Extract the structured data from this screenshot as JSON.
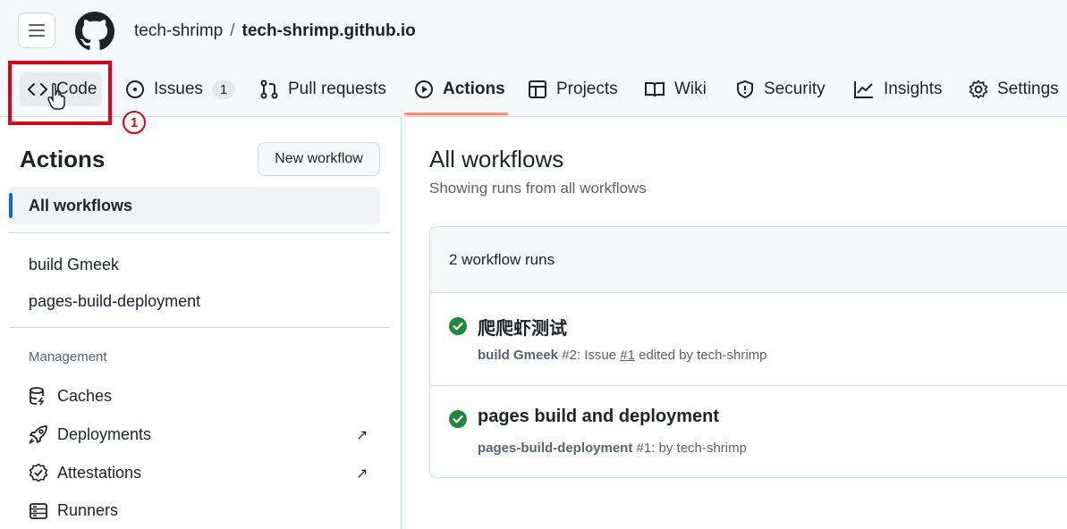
{
  "header": {
    "owner": "tech-shrimp",
    "separator": "/",
    "repo": "tech-shrimp.github.io"
  },
  "tabs": [
    {
      "label": "Code",
      "icon": "code-icon"
    },
    {
      "label": "Issues",
      "icon": "issue-opened-icon",
      "count": "1"
    },
    {
      "label": "Pull requests",
      "icon": "git-pull-request-icon"
    },
    {
      "label": "Actions",
      "icon": "play-icon",
      "active": true
    },
    {
      "label": "Projects",
      "icon": "table-icon"
    },
    {
      "label": "Wiki",
      "icon": "book-icon"
    },
    {
      "label": "Security",
      "icon": "shield-icon"
    },
    {
      "label": "Insights",
      "icon": "graph-icon"
    },
    {
      "label": "Settings",
      "icon": "gear-icon"
    }
  ],
  "annotation": {
    "step": "1",
    "color": "#e0001b"
  },
  "sidebar": {
    "title": "Actions",
    "new_workflow": "New workflow",
    "all_workflows": "All workflows",
    "workflows": [
      "build Gmeek",
      "pages-build-deployment"
    ],
    "management_heading": "Management",
    "management": [
      {
        "label": "Caches",
        "icon": "database-icon"
      },
      {
        "label": "Deployments",
        "icon": "rocket-icon",
        "external": "↗"
      },
      {
        "label": "Attestations",
        "icon": "verified-icon",
        "external": "↗"
      },
      {
        "label": "Runners",
        "icon": "server-icon"
      }
    ]
  },
  "main": {
    "title": "All workflows",
    "subtitle": "Showing runs from all workflows",
    "runs_count": "2 workflow runs",
    "runs": [
      {
        "title": "爬爬虾测试",
        "workflow": "build Gmeek",
        "run_number": "#2",
        "event_prefix": ": Issue ",
        "issue": "#1",
        "event_suffix": " edited by tech-shrimp",
        "status": "success"
      },
      {
        "title": "pages build and deployment",
        "workflow": "pages-build-deployment",
        "run_number": "#1",
        "event_prefix": ": by tech-shrimp",
        "issue": "",
        "event_suffix": "",
        "status": "success"
      }
    ]
  },
  "colors": {
    "accent_underline": "#fd8c73",
    "success": "#1f883d",
    "selected_bar": "#0969da"
  }
}
